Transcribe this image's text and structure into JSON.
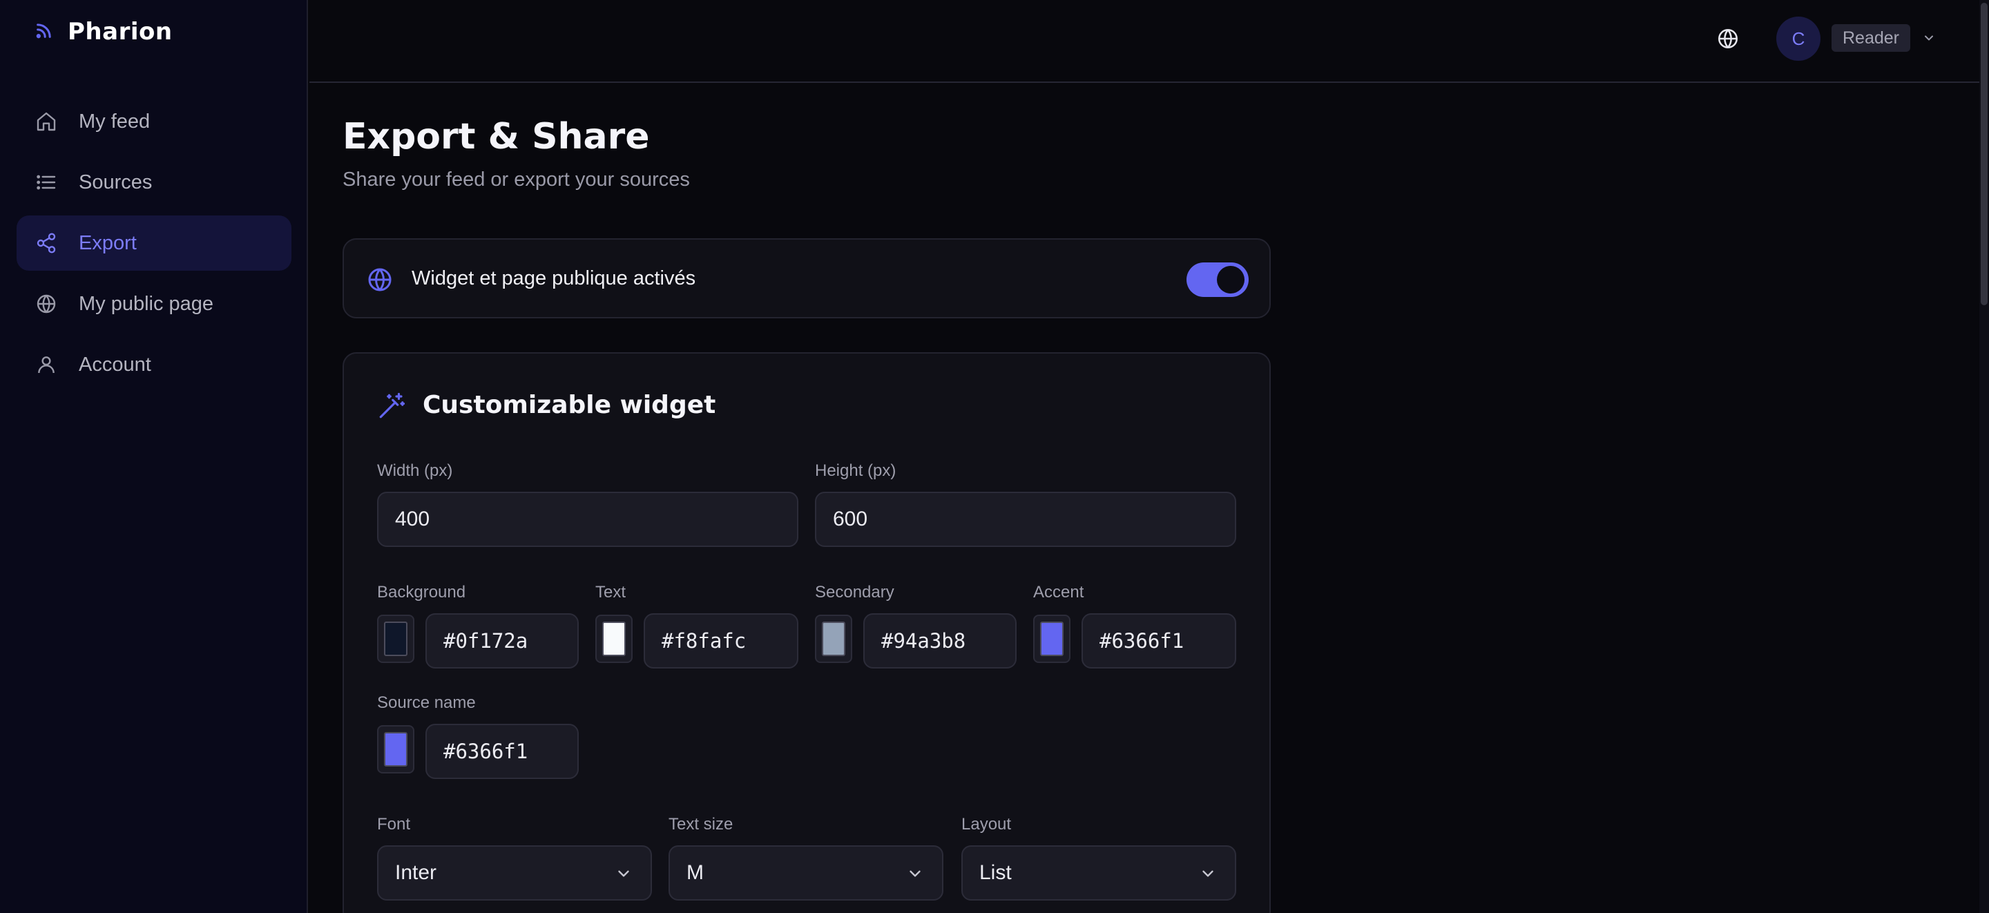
{
  "brand": {
    "name": "Pharion"
  },
  "sidebar": {
    "items": [
      {
        "label": "My feed",
        "icon": "home-icon",
        "active": false
      },
      {
        "label": "Sources",
        "icon": "list-icon",
        "active": false
      },
      {
        "label": "Export",
        "icon": "share-icon",
        "active": true
      },
      {
        "label": "My public page",
        "icon": "globe-icon",
        "active": false
      },
      {
        "label": "Account",
        "icon": "user-icon",
        "active": false
      }
    ]
  },
  "header": {
    "avatar_initial": "C",
    "role": "Reader"
  },
  "page": {
    "title": "Export & Share",
    "subtitle": "Share your feed or export your sources"
  },
  "toggle_card": {
    "label": "Widget et page publique activés",
    "enabled": true
  },
  "widget": {
    "title": "Customizable widget",
    "width": {
      "label": "Width (px)",
      "value": "400"
    },
    "height": {
      "label": "Height (px)",
      "value": "600"
    },
    "colors": [
      {
        "label": "Background",
        "value": "#0f172a"
      },
      {
        "label": "Text",
        "value": "#f8fafc"
      },
      {
        "label": "Secondary",
        "value": "#94a3b8"
      },
      {
        "label": "Accent",
        "value": "#6366f1"
      },
      {
        "label": "Source name",
        "value": "#6366f1"
      }
    ],
    "font": {
      "label": "Font",
      "value": "Inter"
    },
    "text_size": {
      "label": "Text size",
      "value": "M"
    },
    "layout": {
      "label": "Layout",
      "value": "List"
    }
  },
  "theme": {
    "accent": "#6366f1",
    "active_nav_bg": "#14143a",
    "sidebar_bg": "#09091a"
  }
}
